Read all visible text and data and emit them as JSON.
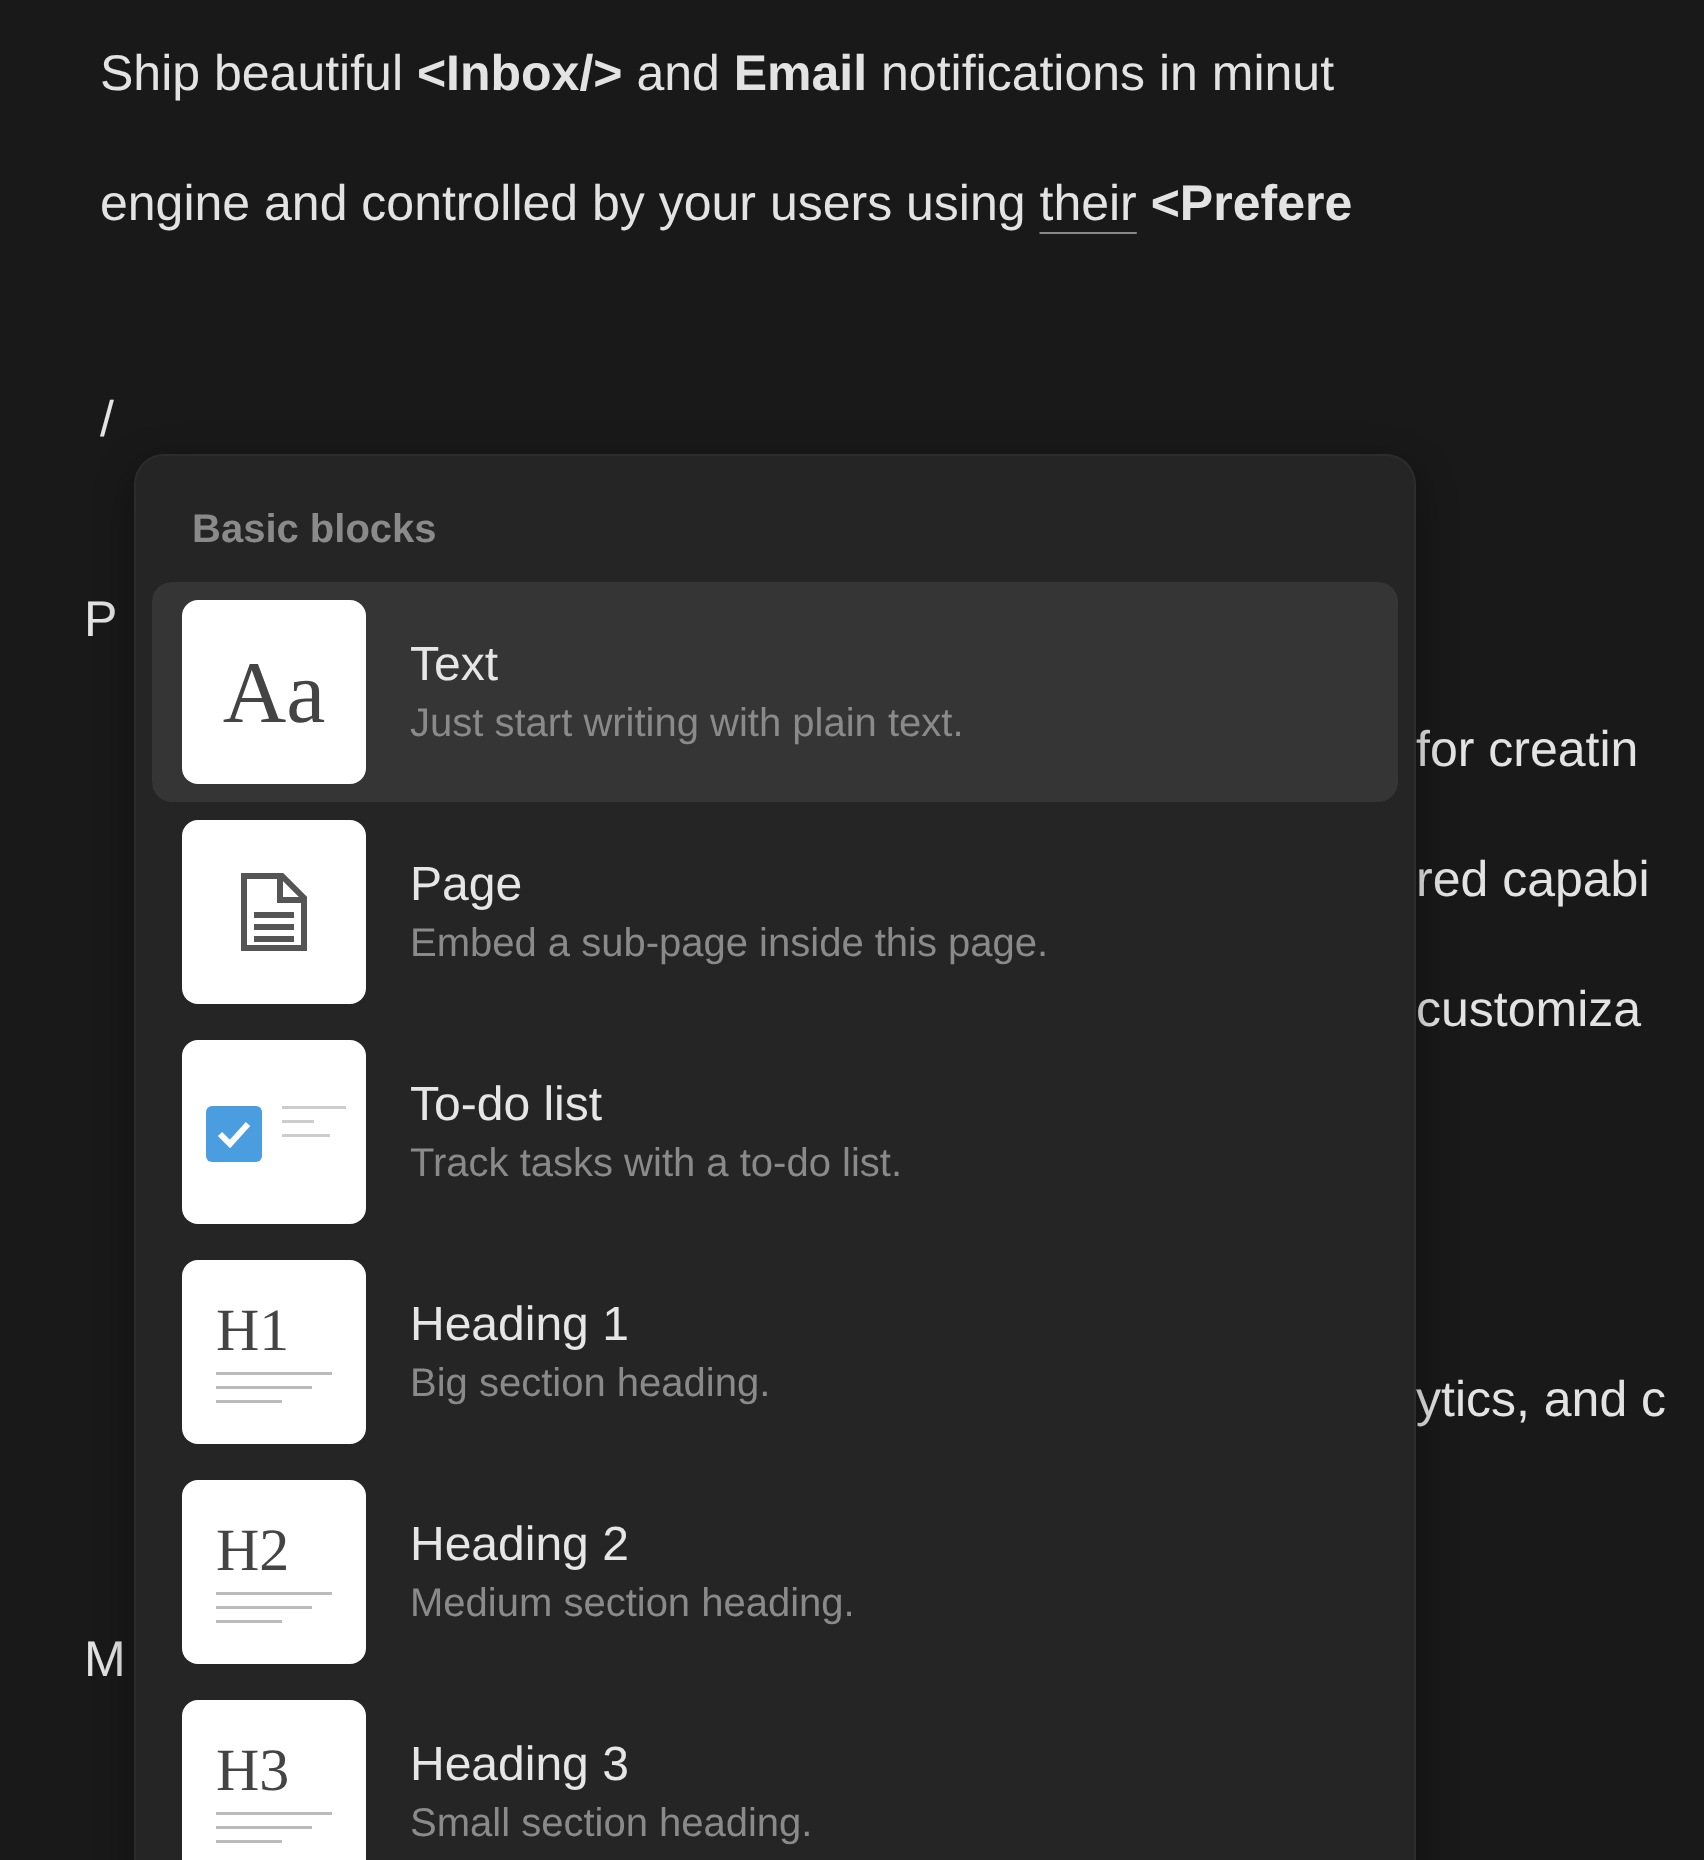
{
  "document": {
    "paragraph": [
      "Ship beautiful **<Inbox/>** and **Email** notifications in minut",
      "engine and controlled by your users using "
    ],
    "link": "their",
    "after_link": "<Prefere",
    "slash": "/",
    "lines": [
      {
        "left": "P"
      },
      {
        "right": "for creatin"
      },
      {
        "right": "red capabi"
      },
      {
        "right": "customiza"
      },
      {
        "right": "ytics, and c"
      },
      {
        "left": "M"
      }
    ]
  },
  "menu": {
    "section": "Basic blocks",
    "items": [
      {
        "kind": "text",
        "glyph": "Aa",
        "title": "Text",
        "description": "Just start writing with plain text.",
        "selected": true
      },
      {
        "kind": "page",
        "title": "Page",
        "description": "Embed a sub-page inside this page.",
        "selected": false
      },
      {
        "kind": "todo",
        "title": "To-do list",
        "description": "Track tasks with a to-do list.",
        "selected": false
      },
      {
        "kind": "heading",
        "glyph": "H1",
        "title": "Heading 1",
        "description": "Big section heading.",
        "selected": false
      },
      {
        "kind": "heading",
        "glyph": "H2",
        "title": "Heading 2",
        "description": "Medium section heading.",
        "selected": false
      },
      {
        "kind": "heading",
        "glyph": "H3",
        "title": "Heading 3",
        "description": "Small section heading.",
        "selected": false
      }
    ]
  }
}
